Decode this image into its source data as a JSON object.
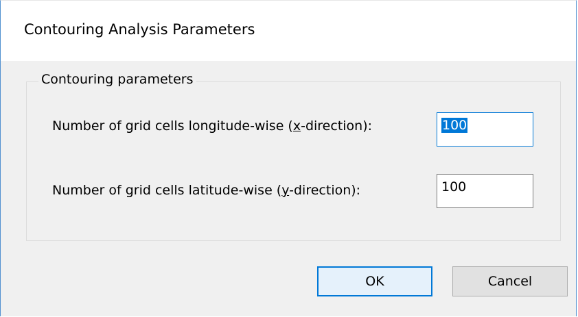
{
  "window": {
    "title": "Contouring Analysis Parameters"
  },
  "group": {
    "caption": "Contouring parameters"
  },
  "fields": {
    "x": {
      "label_before": "Number of grid cells longitude-wise (",
      "label_mnemonic": "x",
      "label_after": "-direction):",
      "value": "100"
    },
    "y": {
      "label_before": "Number of grid cells latitude-wise (",
      "label_mnemonic": "y",
      "label_after": "-direction):",
      "value": "100"
    }
  },
  "buttons": {
    "ok_label": "OK",
    "cancel_label": "Cancel"
  },
  "colors": {
    "accent": "#0078d7",
    "dialog_background": "#f0f0f0"
  }
}
